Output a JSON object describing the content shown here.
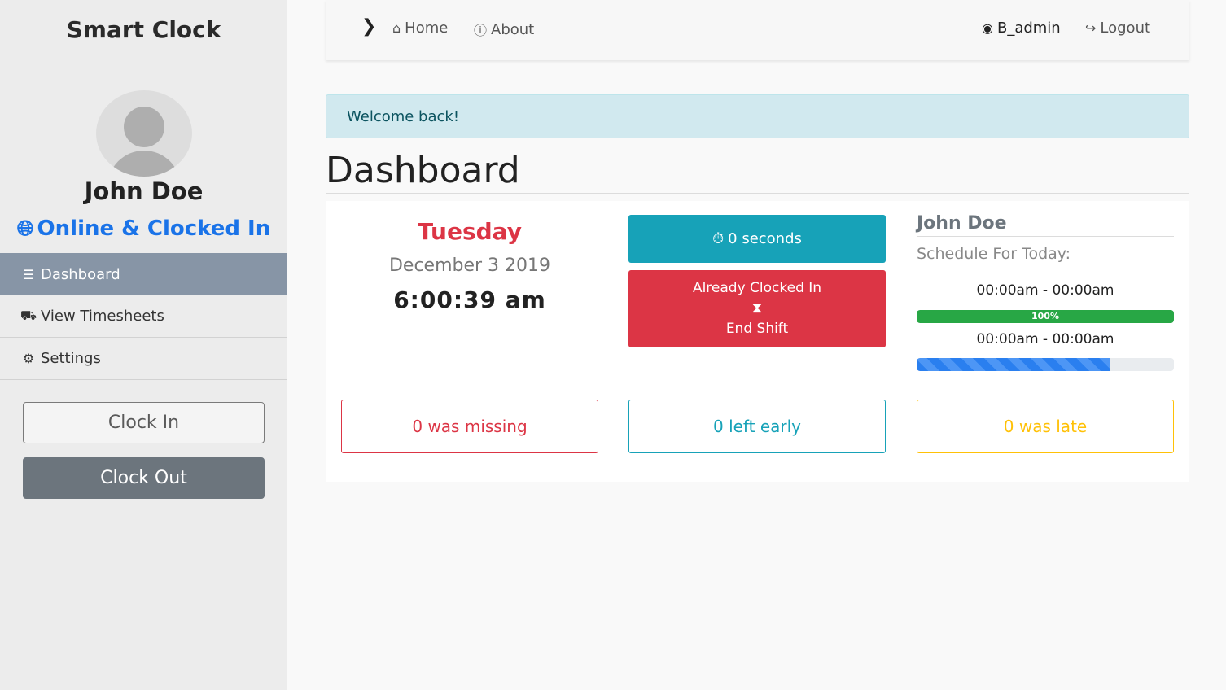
{
  "sidebar": {
    "brand": "Smart Clock",
    "user_name": "John Doe",
    "status": "Online & Clocked In",
    "nav": [
      {
        "label": "Dashboard",
        "icon": "list-icon",
        "active": true
      },
      {
        "label": "View Timesheets",
        "icon": "truck-clock-icon"
      },
      {
        "label": "Settings",
        "icon": "gear-icon"
      }
    ],
    "clock_in_label": "Clock In",
    "clock_out_label": "Clock Out"
  },
  "topbar": {
    "home_label": "Home",
    "about_label": "About",
    "user_label": "B_admin",
    "logout_label": "Logout"
  },
  "alert": {
    "text": "Welcome back!"
  },
  "page": {
    "title": "Dashboard"
  },
  "clock": {
    "day": "Tuesday",
    "date": "December 3 2019",
    "time": "6:00:39 am"
  },
  "shift": {
    "timer": "0 seconds",
    "status": "Already Clocked In",
    "end_label": "End Shift"
  },
  "schedule": {
    "name": "John Doe",
    "label": "Schedule For Today:",
    "entries": [
      {
        "time": "00:00am - 00:00am",
        "progress_label": "100%",
        "progress": 100
      },
      {
        "time": "00:00am - 00:00am",
        "progress_label": "",
        "progress": 75
      }
    ]
  },
  "stats": {
    "missing": "0 was missing",
    "left_early": "0 left early",
    "late": "0 was late"
  },
  "colors": {
    "accent": "#1a73e8",
    "danger": "#dc3545",
    "info": "#17a2b8",
    "warning": "#ffc107",
    "success": "#28a745",
    "sidebar_active": "#8795a6"
  }
}
